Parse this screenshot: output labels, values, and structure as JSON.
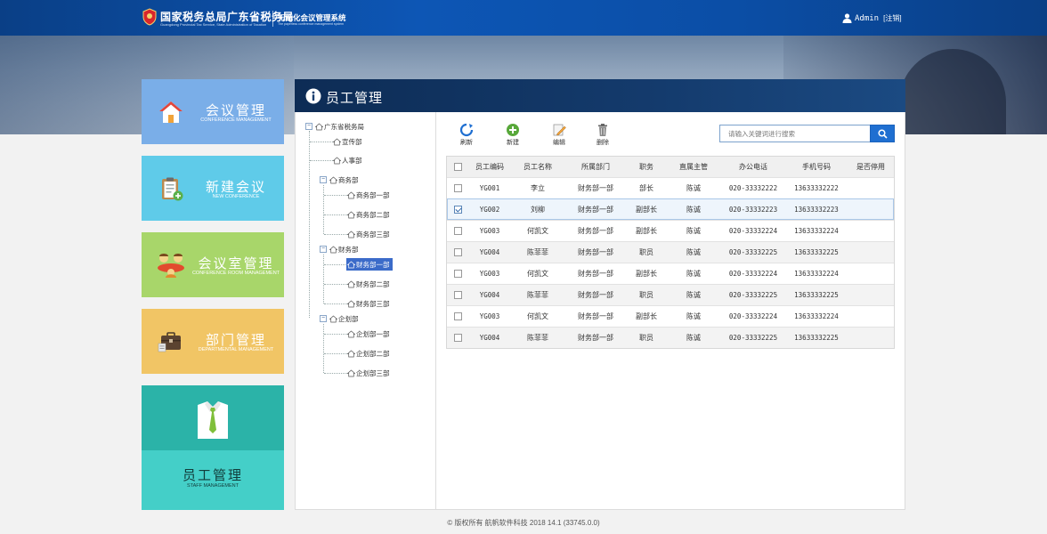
{
  "header": {
    "org_title": "国家税务总局广东省税务局",
    "org_subtitle": "Guangdong Provincial Tax Service, State Administration of Taxation",
    "system_title": "无纸化会议管理系统",
    "system_subtitle": "The paperless conference management system",
    "username": "Admin",
    "logout_label": "[注销]"
  },
  "nav": {
    "meeting": {
      "cn": "会议管理",
      "en": "CONFERENCE MANAGEMENT",
      "icon": "house-icon",
      "color": "#7aaee8"
    },
    "new_meeting": {
      "cn": "新建会议",
      "en": "NEW CONFERENCE",
      "icon": "clipboard-add-icon",
      "color": "#5fcbe9"
    },
    "room": {
      "cn": "会议室管理",
      "en": "CONFERENCE ROOM MANAGEMENT",
      "icon": "meeting-people-icon",
      "color": "#a8d66a"
    },
    "department": {
      "cn": "部门管理",
      "en": "DEPARTMENTAL MANAGEMENT",
      "icon": "briefcase-icon",
      "color": "#f1c565"
    },
    "staff": {
      "cn": "员工管理",
      "en": "STAFF MANAGEMENT",
      "icon": "shirt-tie-icon",
      "color": "#2bb3a8"
    }
  },
  "panel": {
    "title": "员工管理"
  },
  "tree": {
    "root": "广东省税务局",
    "nodes": {
      "xuanchuan": "宣传部",
      "renshi": "人事部",
      "shangwu": "商务部",
      "shangwu1": "商务部一部",
      "shangwu2": "商务部二部",
      "shangwu3": "商务部三部",
      "caiwu": "财务部",
      "caiwu1": "财务部一部",
      "caiwu2": "财务部二部",
      "caiwu3": "财务部三部",
      "qihua": "企划部",
      "qihua1": "企划部一部",
      "qihua2": "企划部二部",
      "qihua3": "企划部三部"
    },
    "selected": "财务部一部"
  },
  "toolbar": {
    "refresh": "刷新",
    "create": "新建",
    "edit": "编辑",
    "delete": "删除",
    "search_placeholder": "请输入关键词进行搜索"
  },
  "table": {
    "columns": [
      "员工编码",
      "员工名称",
      "所属部门",
      "职务",
      "直属主管",
      "办公电话",
      "手机号码",
      "是否停用"
    ],
    "rows": [
      {
        "checked": false,
        "code": "YG001",
        "name": "李立",
        "dept": "财务部一部",
        "title": "部长",
        "manager": "陈诚",
        "office": "020-33332222",
        "mobile": "13633332222",
        "disabled": ""
      },
      {
        "checked": true,
        "code": "YG002",
        "name": "刘柳",
        "dept": "财务部一部",
        "title": "副部长",
        "manager": "陈诚",
        "office": "020-33332223",
        "mobile": "13633332223",
        "disabled": ""
      },
      {
        "checked": false,
        "code": "YG003",
        "name": "何凯文",
        "dept": "财务部一部",
        "title": "副部长",
        "manager": "陈诚",
        "office": "020-33332224",
        "mobile": "13633332224",
        "disabled": ""
      },
      {
        "checked": false,
        "code": "YG004",
        "name": "陈菲菲",
        "dept": "财务部一部",
        "title": "职员",
        "manager": "陈诚",
        "office": "020-33332225",
        "mobile": "13633332225",
        "disabled": ""
      },
      {
        "checked": false,
        "code": "YG003",
        "name": "何凯文",
        "dept": "财务部一部",
        "title": "副部长",
        "manager": "陈诚",
        "office": "020-33332224",
        "mobile": "13633332224",
        "disabled": ""
      },
      {
        "checked": false,
        "code": "YG004",
        "name": "陈菲菲",
        "dept": "财务部一部",
        "title": "职员",
        "manager": "陈诚",
        "office": "020-33332225",
        "mobile": "13633332225",
        "disabled": ""
      },
      {
        "checked": false,
        "code": "YG003",
        "name": "何凯文",
        "dept": "财务部一部",
        "title": "副部长",
        "manager": "陈诚",
        "office": "020-33332224",
        "mobile": "13633332224",
        "disabled": ""
      },
      {
        "checked": false,
        "code": "YG004",
        "name": "陈菲菲",
        "dept": "财务部一部",
        "title": "职员",
        "manager": "陈诚",
        "office": "020-33332225",
        "mobile": "13633332225",
        "disabled": ""
      }
    ]
  },
  "footer": {
    "text": "© 版权所有 航帆软件科技 2018   14.1 (33745.0.0)"
  }
}
